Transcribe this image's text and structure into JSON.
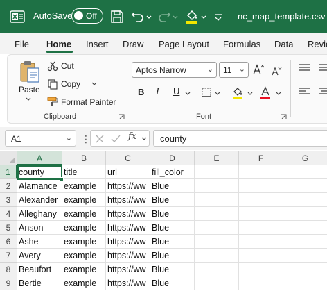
{
  "titlebar": {
    "autosave_label": "AutoSave",
    "autosave_state": "Off",
    "filename": "nc_map_template.csv"
  },
  "tabs": [
    "File",
    "Home",
    "Insert",
    "Draw",
    "Page Layout",
    "Formulas",
    "Data",
    "Revie"
  ],
  "ribbon": {
    "clipboard": {
      "paste": "Paste",
      "cut": "Cut",
      "copy": "Copy",
      "format_painter": "Format Painter",
      "label": "Clipboard"
    },
    "font": {
      "name": "Aptos Narrow",
      "size": "11",
      "label": "Font",
      "highlight_color": "#f2e600",
      "font_color": "#e81123"
    }
  },
  "formula_bar": {
    "cell_ref": "A1",
    "fx": "fx",
    "content": "county"
  },
  "grid": {
    "columns": [
      "A",
      "B",
      "C",
      "D",
      "E",
      "F",
      "G"
    ],
    "rows": [
      "1",
      "2",
      "3",
      "4",
      "5",
      "6",
      "7",
      "8",
      "9"
    ],
    "cells": [
      [
        "county",
        "title",
        "url",
        "fill_color"
      ],
      [
        "Alamance",
        "example",
        "https://ww",
        "Blue"
      ],
      [
        "Alexander",
        "example",
        "https://ww",
        "Blue"
      ],
      [
        "Alleghany",
        "example",
        "https://ww",
        "Blue"
      ],
      [
        "Anson",
        "example",
        "https://ww",
        "Blue"
      ],
      [
        "Ashe",
        "example",
        "https://ww",
        "Blue"
      ],
      [
        "Avery",
        "example",
        "https://ww",
        "Blue"
      ],
      [
        "Beaufort",
        "example",
        "https://ww",
        "Blue"
      ],
      [
        "Bertie",
        "example",
        "https://ww",
        "Blue"
      ]
    ]
  },
  "colors": {
    "excel_green": "#1e7145",
    "ribbon_bg": "#f3f3f3"
  }
}
